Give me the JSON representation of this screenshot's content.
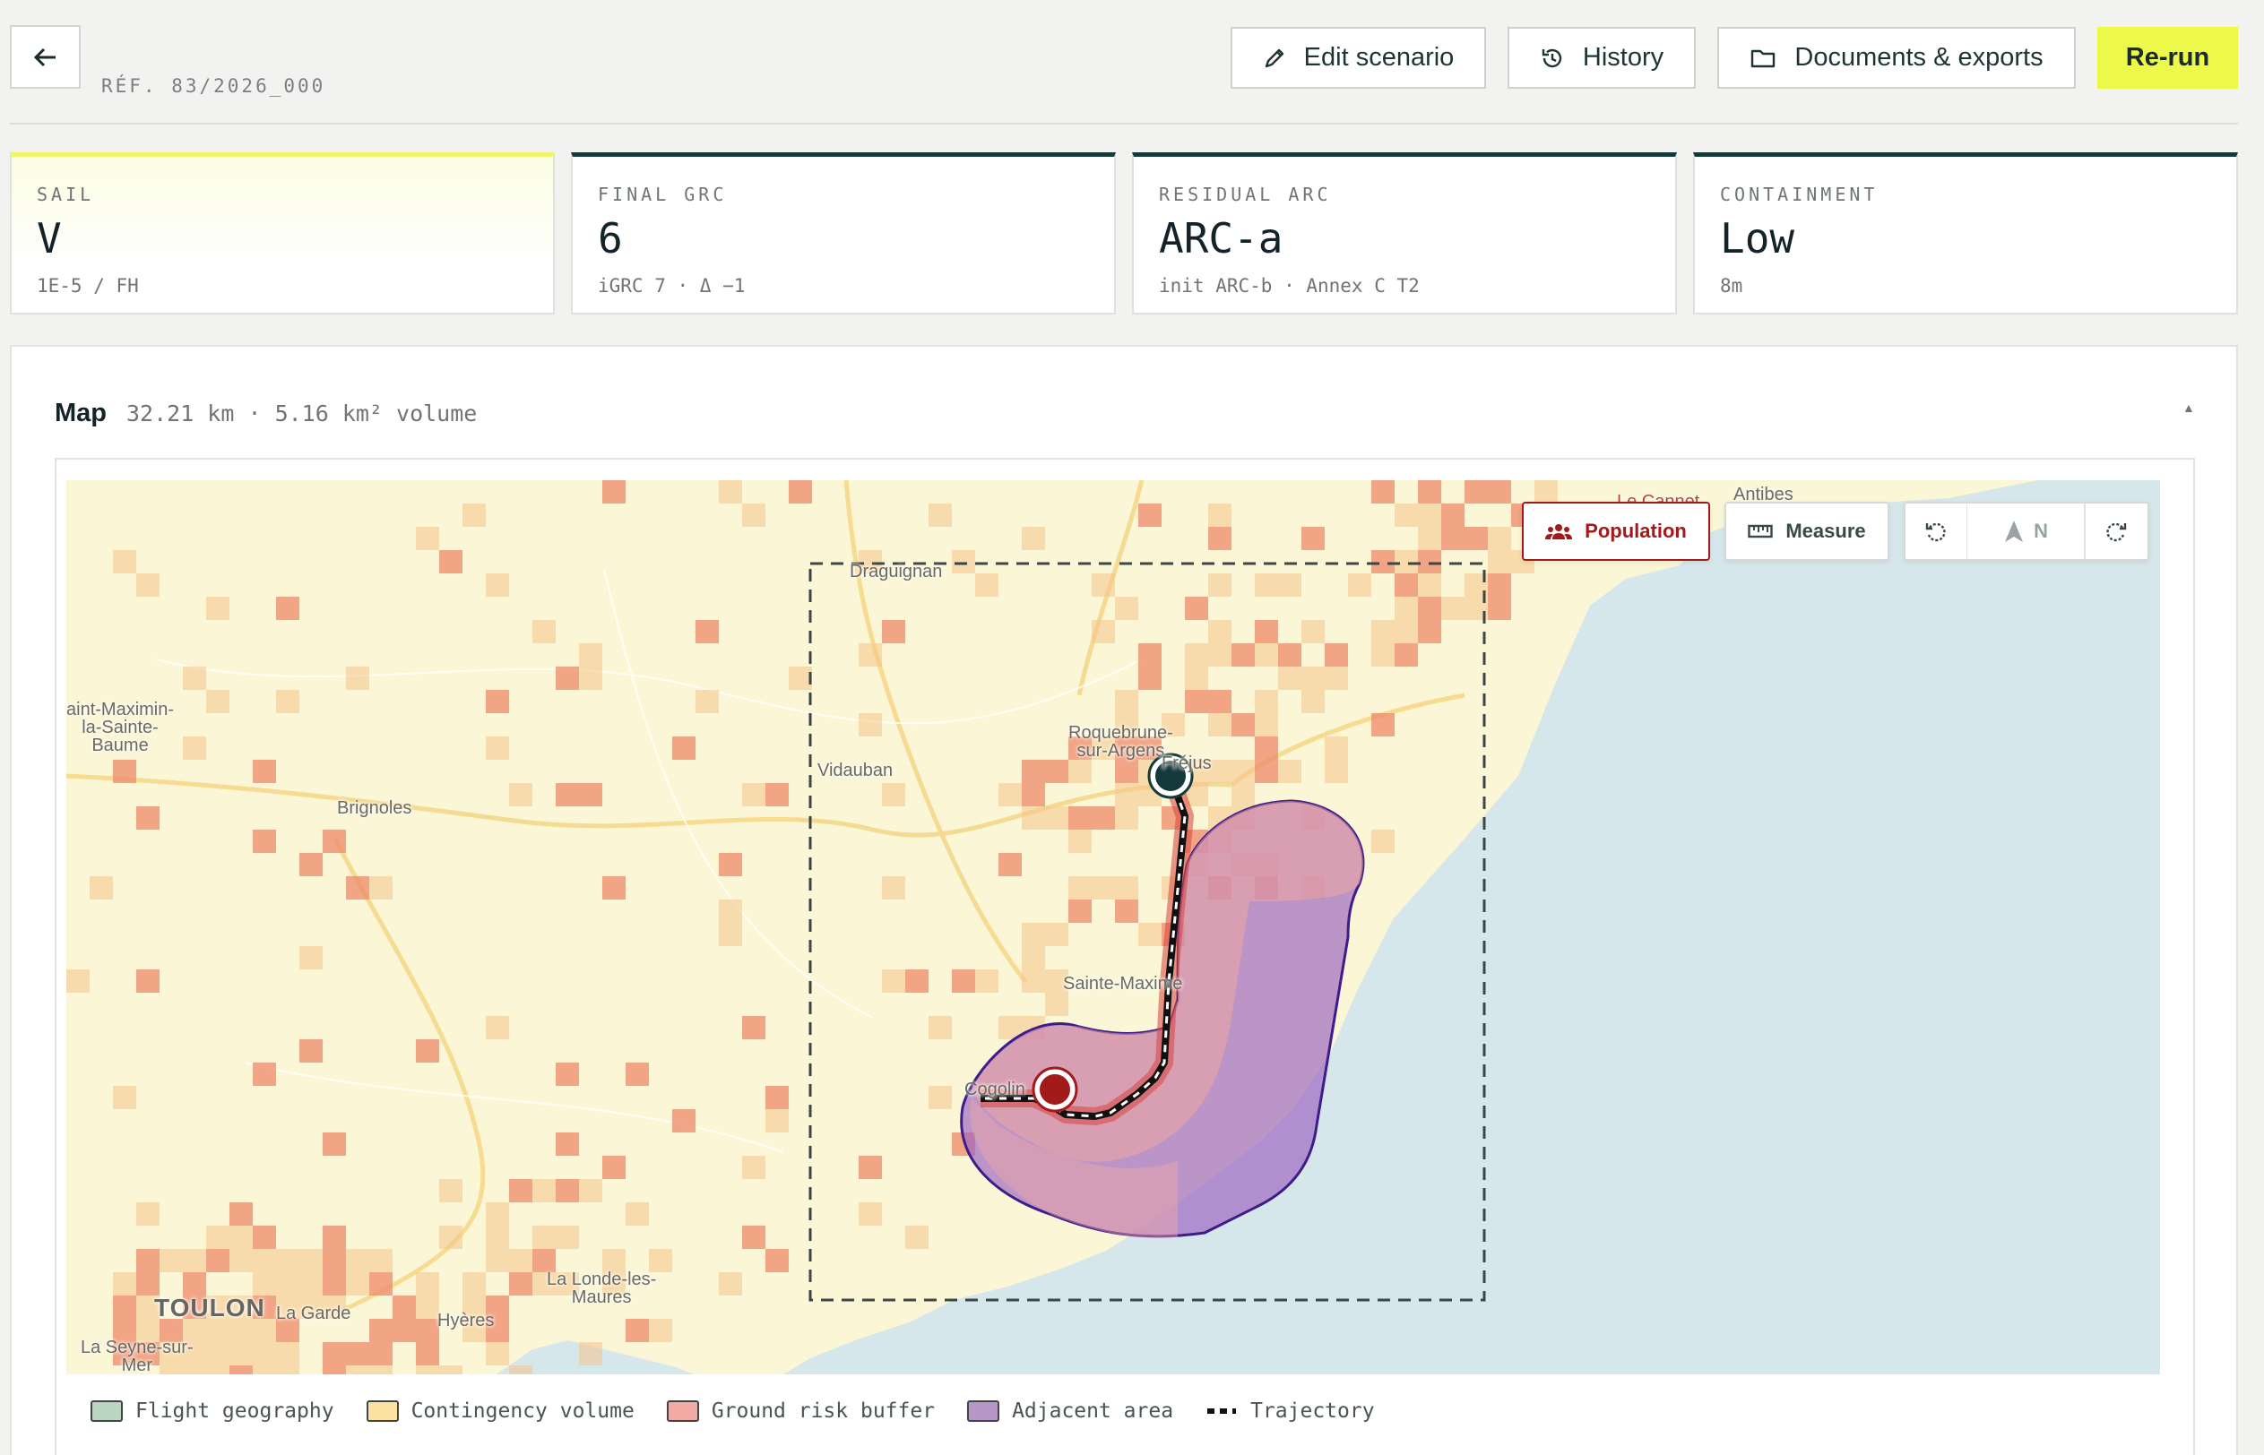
{
  "header": {
    "back_label": "",
    "reference": "RÉF. 83/2026_000",
    "buttons": {
      "edit": "Edit scenario",
      "history": "History",
      "documents": "Documents & exports",
      "rerun": "Re-run"
    }
  },
  "metrics": [
    {
      "label": "SAIL",
      "value": "V",
      "sub": "1E-5 / FH"
    },
    {
      "label": "FINAL GRC",
      "value": "6",
      "sub": "iGRC 7 · Δ −1"
    },
    {
      "label": "RESIDUAL ARC",
      "value": "ARC-a",
      "sub": "init ARC-b · Annex C T2"
    },
    {
      "label": "CONTAINMENT",
      "value": "Low",
      "sub": "8m"
    }
  ],
  "map_panel": {
    "title": "Map",
    "subtitle": "32.21 km · 5.16 km² volume",
    "collapse_glyph": "▲",
    "controls": {
      "population": "Population",
      "measure": "Measure",
      "north": "N"
    },
    "places": {
      "antibes": "Antibes",
      "le_cannet": "Le Cannet",
      "draguignan": "Draguignan",
      "saint_maximin": "aint-Maximin-\nla-Sainte-\nBaume",
      "brignoles": "Brignoles",
      "vidauban": "Vidauban",
      "roquebrune": "Roquebrune-\nsur-Argens",
      "frejus": "Fréjus",
      "sainte_maxime": "Sainte-Maxime",
      "cogolin": "Cogolin",
      "toulon": "TOULON",
      "la_garde": "La Garde",
      "hyeres": "Hyères",
      "la_londe": "La Londe-les-\nMaures",
      "la_seyne": "La Seyne-sur-\nMer"
    },
    "legend": [
      {
        "label": "Flight geography",
        "color": "#b9d6c1"
      },
      {
        "label": "Contingency volume",
        "color": "#fbe2a0"
      },
      {
        "label": "Ground risk buffer",
        "color": "#f3a9a4"
      },
      {
        "label": "Adjacent area",
        "color": "#b796c9"
      },
      {
        "label": "Trajectory",
        "color": "#111111"
      }
    ]
  }
}
